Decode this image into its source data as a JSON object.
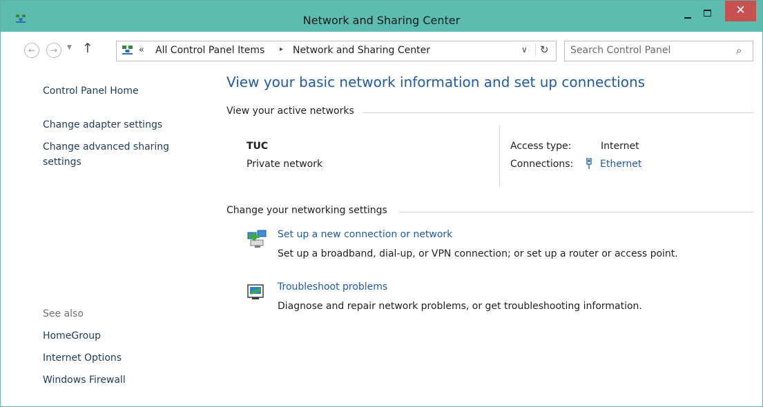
{
  "window": {
    "title": "Network and Sharing Center",
    "close_glyph": "✕"
  },
  "nav": {
    "back_glyph": "←",
    "forward_glyph": "→",
    "up_glyph": "↑",
    "breadcrumb_chevron": "«",
    "breadcrumb": [
      "All Control Panel Items",
      "Network and Sharing Center"
    ],
    "breadcrumb_separator": "▸",
    "search_placeholder": "Search Control Panel"
  },
  "sidebar": {
    "links": [
      "Control Panel Home",
      "Change adapter settings",
      "Change advanced sharing",
      "settings"
    ],
    "see_also_label": "See also",
    "see_also": [
      "HomeGroup",
      "Internet Options",
      "Windows Firewall"
    ]
  },
  "main": {
    "heading": "View your basic network information and set up connections",
    "active_networks_label": "View your active networks",
    "network": {
      "name": "TUC",
      "category": "Private network",
      "access_type_label": "Access type:",
      "access_type_value": "Internet",
      "connections_label": "Connections:",
      "connections_value": "Ethernet"
    },
    "change_settings_label": "Change your networking settings",
    "tasks": [
      {
        "title": "Set up a new connection or network",
        "description": "Set up a broadband, dial-up, or VPN connection; or set up a router or access point."
      },
      {
        "title": "Troubleshoot problems",
        "description": "Diagnose and repair network problems, or get troubleshooting information."
      }
    ]
  },
  "colors": {
    "titlebar": "#5cbcb0",
    "close_button": "#c75050",
    "link_blue": "#1e5aa8",
    "heading_blue": "#1e5aa8"
  }
}
